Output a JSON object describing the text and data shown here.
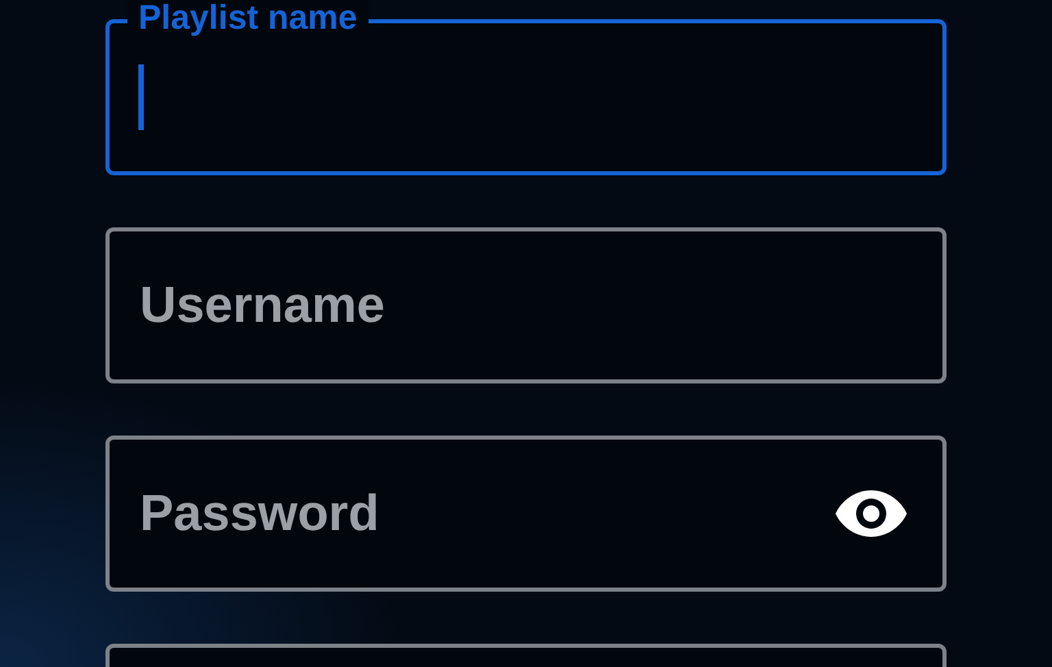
{
  "fields": [
    {
      "kind": "text",
      "label": "Playlist name",
      "focused": true
    },
    {
      "kind": "text",
      "placeholder": "Username",
      "focused": false
    },
    {
      "kind": "password",
      "placeholder": "Password",
      "focused": false
    },
    {
      "kind": "text",
      "focused": false
    }
  ]
}
